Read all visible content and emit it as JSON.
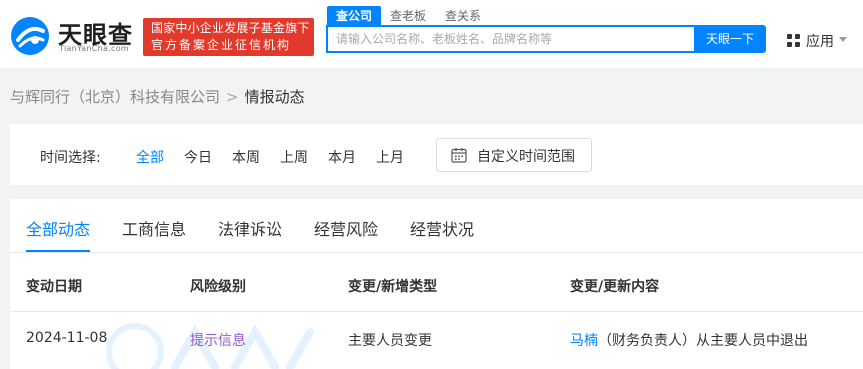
{
  "header": {
    "logo_text": "天眼查",
    "logo_subtext": "TianYanCha.com",
    "badge_line1": "国家中小企业发展子基金旗下",
    "badge_line2": "官方备案企业征信机构",
    "search_tabs": [
      "查公司",
      "查老板",
      "查关系"
    ],
    "search_placeholder": "请输入公司名称、老板姓名、品牌名称等",
    "search_button": "天眼一下",
    "apps_label": "应用"
  },
  "breadcrumb": {
    "company": "与辉同行（北京）科技有限公司",
    "separator": ">",
    "current": "情报动态"
  },
  "time_filter": {
    "label": "时间选择:",
    "options": [
      "全部",
      "今日",
      "本周",
      "上周",
      "本月",
      "上月"
    ],
    "selected": "全部",
    "custom_range_label": "自定义时间范围"
  },
  "tabs": [
    "全部动态",
    "工商信息",
    "法律诉讼",
    "经营风险",
    "经营状况"
  ],
  "active_tab": "全部动态",
  "table": {
    "headers": [
      "变动日期",
      "风险级别",
      "变更/新增类型",
      "变更/更新内容"
    ],
    "rows": [
      {
        "date": "2024-11-08",
        "risk": "提示信息",
        "type": "主要人员变更",
        "content_person": "马楠",
        "content_rest": "（财务负责人）从主要人员中退出"
      }
    ]
  },
  "colors": {
    "accent": "#0084ff",
    "badge_red": "#e13a2c",
    "risk_purple": "#8f5bcf"
  },
  "icons": [
    "tianyancha-logo-icon",
    "apps-grid-icon",
    "chevron-down-icon",
    "calendar-icon"
  ]
}
